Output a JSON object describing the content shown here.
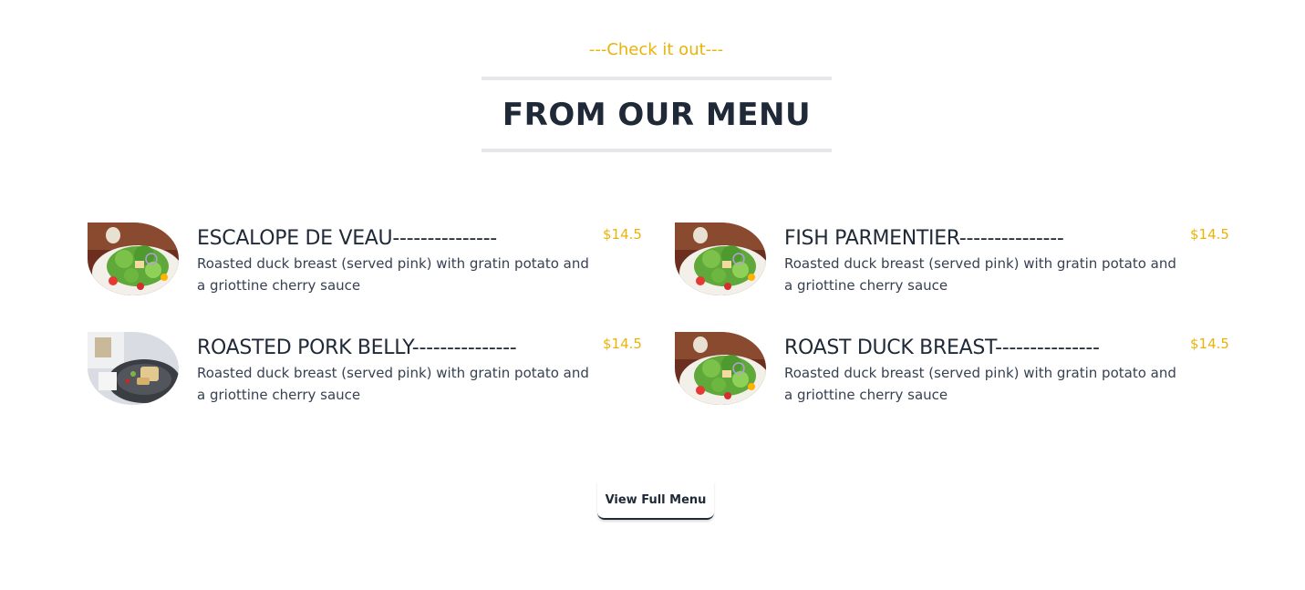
{
  "header": {
    "eyebrow": "---Check it out---",
    "title": "FROM OUR MENU"
  },
  "menu": {
    "items": [
      {
        "name": "ESCALOPE DE VEAU---------------",
        "description": "Roasted duck breast (served pink) with gratin potato and a griottine cherry sauce",
        "price": "$14.5",
        "image": "salad-photo"
      },
      {
        "name": "FISH PARMENTIER---------------",
        "description": "Roasted duck breast (served pink) with gratin potato and a griottine cherry sauce",
        "price": "$14.5",
        "image": "salad-photo"
      },
      {
        "name": "ROASTED PORK BELLY---------------",
        "description": "Roasted duck breast (served pink) with gratin potato and a griottine cherry sauce",
        "price": "$14.5",
        "image": "plated-dish-photo"
      },
      {
        "name": "ROAST DUCK BREAST---------------",
        "description": "Roasted duck breast (served pink) with gratin potato and a griottine cherry sauce",
        "price": "$14.5",
        "image": "salad-photo"
      }
    ],
    "button_label": "View Full Menu"
  },
  "colors": {
    "accent": "#eab308",
    "text": "#1f2937",
    "divider": "#e5e7eb"
  }
}
